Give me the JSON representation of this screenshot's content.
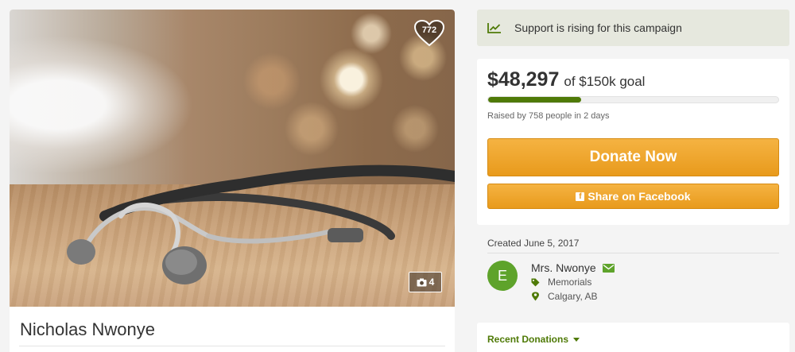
{
  "campaign": {
    "title": "Nicholas Nwonye",
    "like_count": "772",
    "photo_count": "4"
  },
  "trend": {
    "text": "Support is rising for this campaign"
  },
  "funding": {
    "raised": "$48,297",
    "goal_text": "of $150k goal",
    "progress_fraction": 0.32,
    "raised_by_text": "Raised by 758 people in 2 days",
    "donate_label": "Donate Now",
    "share_label": "Share on Facebook"
  },
  "organizer": {
    "created_text": "Created June 5, 2017",
    "avatar_initial": "E",
    "name": "Mrs. Nwonye",
    "category": "Memorials",
    "location": "Calgary, AB"
  },
  "recent": {
    "label": "Recent Donations"
  },
  "colors": {
    "accent_green": "#4f7a07",
    "avatar_green": "#5ea32b",
    "button_orange": "#f0a52a",
    "trend_bg": "#e6e8de"
  },
  "icons": {
    "trend": "trending-up-icon",
    "like": "heart-icon",
    "photos": "camera-icon",
    "mail": "envelope-icon",
    "category": "tag-icon",
    "location": "map-marker-icon",
    "facebook": "facebook-icon"
  }
}
